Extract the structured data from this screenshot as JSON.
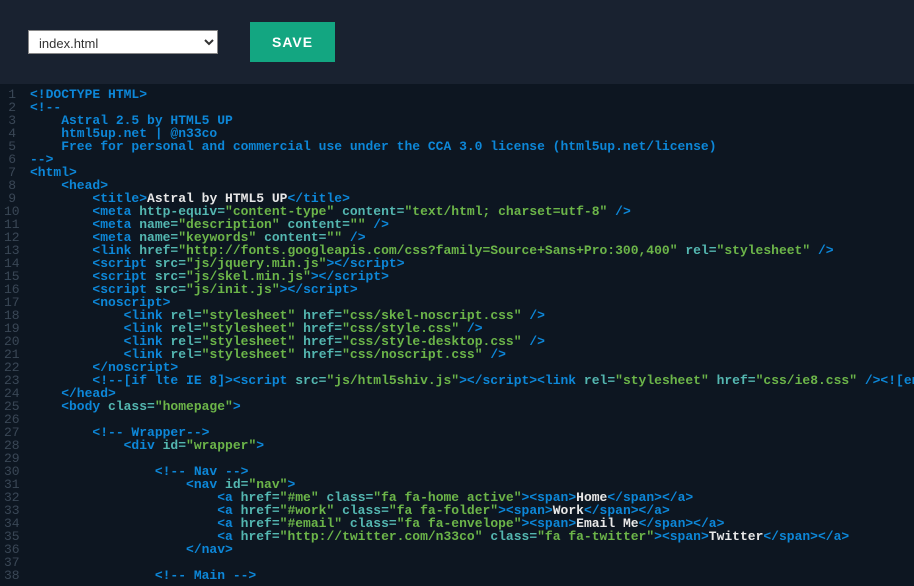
{
  "toolbar": {
    "file_selected": "index.html",
    "save_label": "SAVE"
  },
  "code_lines": [
    [
      [
        "blue",
        "<!DOCTYPE HTML>"
      ]
    ],
    [
      [
        "blue",
        "<!--"
      ]
    ],
    [
      [
        "blue",
        "    Astral 2.5 by HTML5 UP"
      ]
    ],
    [
      [
        "blue",
        "    html5up.net | @n33co"
      ]
    ],
    [
      [
        "blue",
        "    Free for personal and commercial use under the CCA 3.0 license (html5up.net/license)"
      ]
    ],
    [
      [
        "blue",
        "-->"
      ]
    ],
    [
      [
        "blue",
        "<html>"
      ]
    ],
    [
      [
        "blue",
        "    <head>"
      ]
    ],
    [
      [
        "blue",
        "        <title>"
      ],
      [
        "white",
        "Astral by HTML5 UP"
      ],
      [
        "blue",
        "</title>"
      ]
    ],
    [
      [
        "blue",
        "        <meta "
      ],
      [
        "cyan",
        "http-equiv="
      ],
      [
        "green",
        "\"content-type\""
      ],
      [
        "blue",
        " "
      ],
      [
        "cyan",
        "content="
      ],
      [
        "green",
        "\"text/html; charset=utf-8\""
      ],
      [
        "blue",
        " />"
      ]
    ],
    [
      [
        "blue",
        "        <meta "
      ],
      [
        "cyan",
        "name="
      ],
      [
        "green",
        "\"description\""
      ],
      [
        "blue",
        " "
      ],
      [
        "cyan",
        "content="
      ],
      [
        "green",
        "\"\""
      ],
      [
        "blue",
        " />"
      ]
    ],
    [
      [
        "blue",
        "        <meta "
      ],
      [
        "cyan",
        "name="
      ],
      [
        "green",
        "\"keywords\""
      ],
      [
        "blue",
        " "
      ],
      [
        "cyan",
        "content="
      ],
      [
        "green",
        "\"\""
      ],
      [
        "blue",
        " />"
      ]
    ],
    [
      [
        "blue",
        "        <link "
      ],
      [
        "cyan",
        "href="
      ],
      [
        "green",
        "\"http://fonts.googleapis.com/css?family=Source+Sans+Pro:300,400\""
      ],
      [
        "blue",
        " "
      ],
      [
        "cyan",
        "rel="
      ],
      [
        "green",
        "\"stylesheet\""
      ],
      [
        "blue",
        " />"
      ]
    ],
    [
      [
        "blue",
        "        <script "
      ],
      [
        "cyan",
        "src="
      ],
      [
        "green",
        "\"js/jquery.min.js\""
      ],
      [
        "blue",
        "></script>"
      ]
    ],
    [
      [
        "blue",
        "        <script "
      ],
      [
        "cyan",
        "src="
      ],
      [
        "green",
        "\"js/skel.min.js\""
      ],
      [
        "blue",
        "></script>"
      ]
    ],
    [
      [
        "blue",
        "        <script "
      ],
      [
        "cyan",
        "src="
      ],
      [
        "green",
        "\"js/init.js\""
      ],
      [
        "blue",
        "></script>"
      ]
    ],
    [
      [
        "blue",
        "        <noscript>"
      ]
    ],
    [
      [
        "blue",
        "            <link "
      ],
      [
        "cyan",
        "rel="
      ],
      [
        "green",
        "\"stylesheet\""
      ],
      [
        "blue",
        " "
      ],
      [
        "cyan",
        "href="
      ],
      [
        "green",
        "\"css/skel-noscript.css\""
      ],
      [
        "blue",
        " />"
      ]
    ],
    [
      [
        "blue",
        "            <link "
      ],
      [
        "cyan",
        "rel="
      ],
      [
        "green",
        "\"stylesheet\""
      ],
      [
        "blue",
        " "
      ],
      [
        "cyan",
        "href="
      ],
      [
        "green",
        "\"css/style.css\""
      ],
      [
        "blue",
        " />"
      ]
    ],
    [
      [
        "blue",
        "            <link "
      ],
      [
        "cyan",
        "rel="
      ],
      [
        "green",
        "\"stylesheet\""
      ],
      [
        "blue",
        " "
      ],
      [
        "cyan",
        "href="
      ],
      [
        "green",
        "\"css/style-desktop.css\""
      ],
      [
        "blue",
        " />"
      ]
    ],
    [
      [
        "blue",
        "            <link "
      ],
      [
        "cyan",
        "rel="
      ],
      [
        "green",
        "\"stylesheet\""
      ],
      [
        "blue",
        " "
      ],
      [
        "cyan",
        "href="
      ],
      [
        "green",
        "\"css/noscript.css\""
      ],
      [
        "blue",
        " />"
      ]
    ],
    [
      [
        "blue",
        "        </noscript>"
      ]
    ],
    [
      [
        "blue",
        "        <!--[if lte IE 8]><script "
      ],
      [
        "cyan",
        "src="
      ],
      [
        "green",
        "\"js/html5shiv.js\""
      ],
      [
        "blue",
        "></script><link "
      ],
      [
        "cyan",
        "rel="
      ],
      [
        "green",
        "\"stylesheet\""
      ],
      [
        "blue",
        " "
      ],
      [
        "cyan",
        "href="
      ],
      [
        "green",
        "\"css/ie8.css\""
      ],
      [
        "blue",
        " /><![endif]-->"
      ]
    ],
    [
      [
        "blue",
        "    </head>"
      ]
    ],
    [
      [
        "blue",
        "    <body "
      ],
      [
        "cyan",
        "class="
      ],
      [
        "green",
        "\"homepage\""
      ],
      [
        "blue",
        ">"
      ]
    ],
    [
      [
        "blue",
        ""
      ]
    ],
    [
      [
        "blue",
        "        <!-- Wrapper-->"
      ]
    ],
    [
      [
        "blue",
        "            <div "
      ],
      [
        "cyan",
        "id="
      ],
      [
        "green",
        "\"wrapper\""
      ],
      [
        "blue",
        ">"
      ]
    ],
    [
      [
        "blue",
        ""
      ]
    ],
    [
      [
        "blue",
        "                <!-- Nav -->"
      ]
    ],
    [
      [
        "blue",
        "                    <nav "
      ],
      [
        "cyan",
        "id="
      ],
      [
        "green",
        "\"nav\""
      ],
      [
        "blue",
        ">"
      ]
    ],
    [
      [
        "blue",
        "                        <a "
      ],
      [
        "cyan",
        "href="
      ],
      [
        "green",
        "\"#me\""
      ],
      [
        "blue",
        " "
      ],
      [
        "cyan",
        "class="
      ],
      [
        "green",
        "\"fa fa-home active\""
      ],
      [
        "blue",
        "><span>"
      ],
      [
        "white",
        "Home"
      ],
      [
        "blue",
        "</span></a>"
      ]
    ],
    [
      [
        "blue",
        "                        <a "
      ],
      [
        "cyan",
        "href="
      ],
      [
        "green",
        "\"#work\""
      ],
      [
        "blue",
        " "
      ],
      [
        "cyan",
        "class="
      ],
      [
        "green",
        "\"fa fa-folder\""
      ],
      [
        "blue",
        "><span>"
      ],
      [
        "white",
        "Work"
      ],
      [
        "blue",
        "</span></a>"
      ]
    ],
    [
      [
        "blue",
        "                        <a "
      ],
      [
        "cyan",
        "href="
      ],
      [
        "green",
        "\"#email\""
      ],
      [
        "blue",
        " "
      ],
      [
        "cyan",
        "class="
      ],
      [
        "green",
        "\"fa fa-envelope\""
      ],
      [
        "blue",
        "><span>"
      ],
      [
        "white",
        "Email Me"
      ],
      [
        "blue",
        "</span></a>"
      ]
    ],
    [
      [
        "blue",
        "                        <a "
      ],
      [
        "cyan",
        "href="
      ],
      [
        "green",
        "\"http://twitter.com/n33co\""
      ],
      [
        "blue",
        " "
      ],
      [
        "cyan",
        "class="
      ],
      [
        "green",
        "\"fa fa-twitter\""
      ],
      [
        "blue",
        "><span>"
      ],
      [
        "white",
        "Twitter"
      ],
      [
        "blue",
        "</span></a>"
      ]
    ],
    [
      [
        "blue",
        "                    </nav>"
      ]
    ],
    [
      [
        "blue",
        ""
      ]
    ],
    [
      [
        "blue",
        "                <!-- Main -->"
      ]
    ]
  ]
}
